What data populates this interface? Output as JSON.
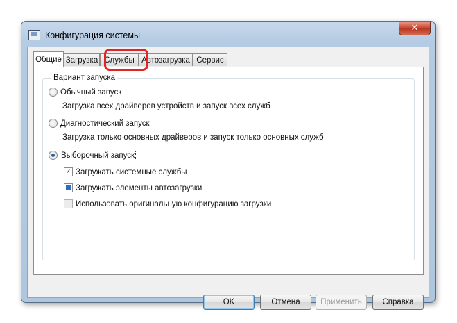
{
  "window": {
    "title": "Конфигурация системы",
    "close_label": "✕"
  },
  "tabs": [
    {
      "label": "Общие",
      "active": true
    },
    {
      "label": "Загрузка",
      "active": false
    },
    {
      "label": "Службы",
      "active": false
    },
    {
      "label": "Автозагрузка",
      "active": false
    },
    {
      "label": "Сервис",
      "active": false
    }
  ],
  "startup": {
    "group_label": "Вариант запуска",
    "normal": {
      "label": "Обычный запуск",
      "description": "Загрузка всех драйверов устройств и запуск всех служб",
      "checked": false
    },
    "diagnostic": {
      "label": "Диагностический запуск",
      "description": "Загрузка только основных драйверов и запуск только основных служб",
      "checked": false
    },
    "selective": {
      "label": "Выборочный запуск",
      "checked": true
    },
    "options": {
      "system_services": {
        "label": "Загружать системные службы",
        "state": "checked"
      },
      "startup_items": {
        "label": "Загружать элементы автозагрузки",
        "state": "indeterminate"
      },
      "original_config": {
        "label": "Использовать оригинальную конфигурацию загрузки",
        "state": "unchecked"
      }
    }
  },
  "buttons": {
    "ok": "OK",
    "cancel": "Отмена",
    "apply": "Применить",
    "help": "Справка"
  },
  "colors": {
    "highlight": "#e02525",
    "window_frame": "#b5cbe3"
  }
}
